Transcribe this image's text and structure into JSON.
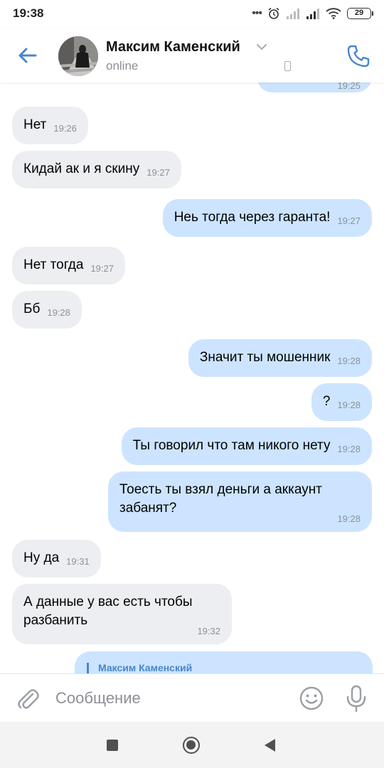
{
  "status_bar": {
    "time": "19:38",
    "battery": "29",
    "icons": [
      "dots-icon",
      "alarm-icon",
      "signal-icon",
      "signal-icon",
      "wifi-icon",
      "battery-icon"
    ]
  },
  "header": {
    "contact_name": "Максим Каменский",
    "status": "online",
    "icons": [
      "back-arrow-icon",
      "chevron-down-icon",
      "mobile-phone-icon",
      "call-icon"
    ]
  },
  "messages": [
    {
      "dir": "in",
      "lines": [
        "Нет"
      ],
      "time": "19:26"
    },
    {
      "dir": "in",
      "lines": [
        "Кидай ак и я скину"
      ],
      "time": "19:27"
    },
    {
      "dir": "out",
      "lines": [
        "Неь тогда через гаранта!"
      ],
      "time": "19:27"
    },
    {
      "dir": "in",
      "lines": [
        "Нет тогда"
      ],
      "time": "19:27"
    },
    {
      "dir": "in",
      "lines": [
        "Бб"
      ],
      "time": "19:28"
    },
    {
      "dir": "out",
      "lines": [
        "Значит ты мошенник"
      ],
      "time": "19:28"
    },
    {
      "dir": "out",
      "lines": [
        "?"
      ],
      "time": "19:28"
    },
    {
      "dir": "out",
      "lines": [
        "Ты говорил что там никого нету"
      ],
      "time": "19:28"
    },
    {
      "dir": "out",
      "lines": [
        "Тоесть ты взял деньги а аккаунт",
        "забанят?"
      ],
      "time": "19:28"
    },
    {
      "dir": "in",
      "lines": [
        "Ну да"
      ],
      "time": "19:31"
    },
    {
      "dir": "in",
      "lines": [
        "А данные у вас есть чтобы",
        "разбанить"
      ],
      "time": "19:32"
    }
  ],
  "top_partial_time": "19:25",
  "reply_preview": {
    "name": "Максим Каменский"
  },
  "composer": {
    "placeholder": "Сообщение",
    "icons": [
      "paperclip-icon",
      "smile-icon",
      "microphone-icon"
    ]
  },
  "nav": {
    "icons": [
      "recent-apps-icon",
      "home-icon",
      "back-icon"
    ]
  },
  "colors": {
    "accent": "#4986cc",
    "bubble_in": "#eceef1",
    "bubble_out": "#cce4ff"
  }
}
